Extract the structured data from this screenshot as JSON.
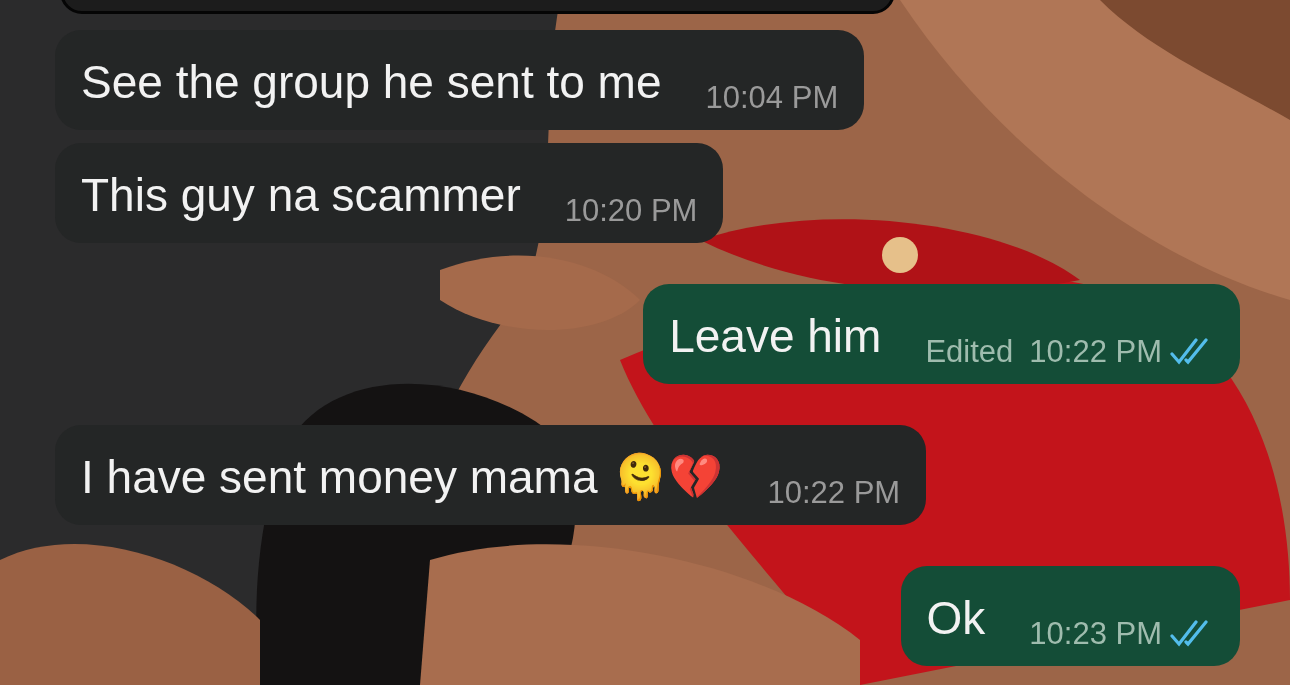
{
  "messages": [
    {
      "kind": "incoming",
      "text": "See the group he sent to me",
      "time": "10:04 PM"
    },
    {
      "kind": "incoming",
      "text": "This guy na scammer",
      "time": "10:20 PM"
    },
    {
      "kind": "outgoing",
      "text": "Leave him",
      "edited_label": "Edited",
      "time": "10:22 PM",
      "read": true
    },
    {
      "kind": "incoming",
      "text": "I have sent money mama",
      "emoji": "🫠💔",
      "time": "10:22 PM"
    },
    {
      "kind": "outgoing",
      "text": "Ok",
      "time": "10:23 PM",
      "read": true
    }
  ]
}
